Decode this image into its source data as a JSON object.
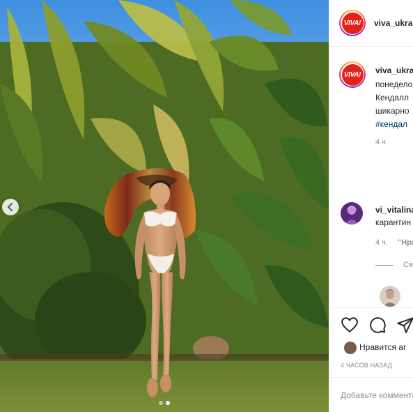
{
  "post": {
    "account": {
      "username": "viva_ukraine",
      "avatar_text": "VIVA!",
      "brand_color": "#e2231a"
    },
    "caption": {
      "lines": [
        "понеделок",
        "Кендалл",
        "шикарно"
      ],
      "hashtag": "#кендал",
      "time": "4 ч."
    },
    "comment": {
      "username": "vi_vitalina",
      "text": "карантин",
      "time": "4 ч.",
      "reply_action": "\"Нравится\"",
      "view_replies": "Смотреть ответы"
    },
    "photo": {
      "carousel_count": 2,
      "active_index": 1
    },
    "actions": {
      "like_icon": "heart-icon",
      "comment_icon": "comment-icon",
      "share_icon": "paper-plane-icon"
    },
    "likes": {
      "text": "Нравится ar"
    },
    "timestamp": "4 ЧАСОВ НАЗАД",
    "add_comment": {
      "placeholder": "Добавьте комментарий..."
    }
  }
}
